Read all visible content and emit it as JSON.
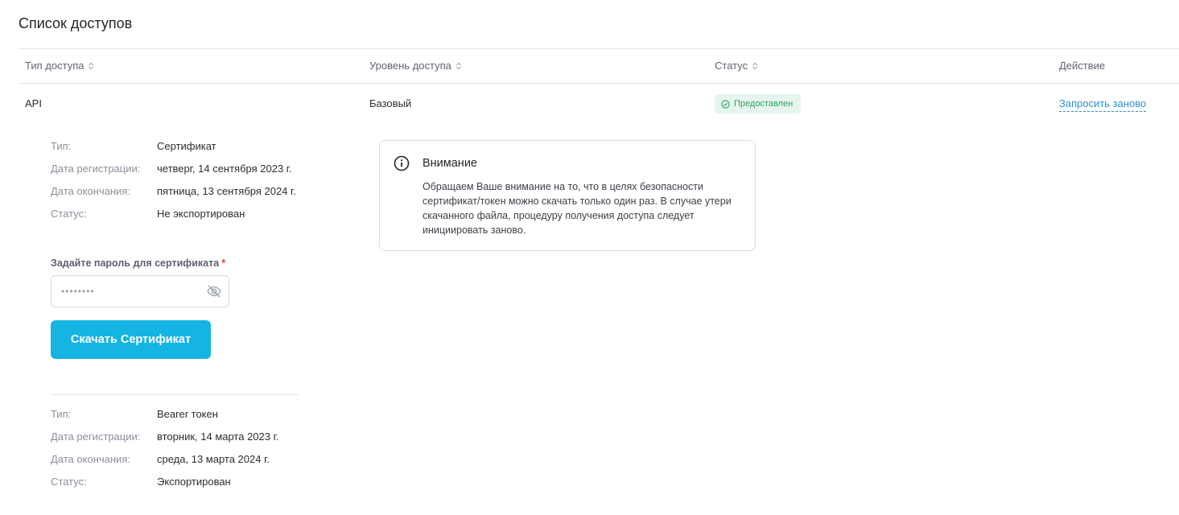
{
  "page": {
    "title": "Список доступов"
  },
  "table": {
    "columns": [
      {
        "label": "Тип доступа",
        "sortable": true
      },
      {
        "label": "Уровень доступа",
        "sortable": true
      },
      {
        "label": "Статус",
        "sortable": true
      },
      {
        "label": "Действие",
        "sortable": false
      }
    ],
    "row": {
      "type": "API",
      "level": "Базовый",
      "status": "Предоставлен",
      "status_color": "#2f9e63",
      "action": "Запросить заново"
    }
  },
  "certificate": {
    "fields": [
      {
        "term": "Тип:",
        "value": "Сертификат"
      },
      {
        "term": "Дата регистрации:",
        "value": "четверг, 14 сентября 2023 г."
      },
      {
        "term": "Дата окончания:",
        "value": "пятница, 13 сентября 2024 г."
      },
      {
        "term": "Статус:",
        "value": "Не экспортирован"
      }
    ],
    "password_label": "Задайте пароль для сертификата",
    "password_required_mark": "*",
    "password_value": "••••••••",
    "download_label": "Скачать Сертификат",
    "accent_color": "#14b4e3"
  },
  "token": {
    "fields": [
      {
        "term": "Тип:",
        "value": "Bearer токен"
      },
      {
        "term": "Дата регистрации:",
        "value": "вторник, 14 марта 2023 г."
      },
      {
        "term": "Дата окончания:",
        "value": "среда, 13 марта 2024 г."
      },
      {
        "term": "Статус:",
        "value": "Экспортирован"
      }
    ]
  },
  "alert": {
    "icon": "info-icon",
    "title": "Внимание",
    "text": "Обращаем Ваше внимание на то, что в целях безопасности сертификат/токен можно скачать только один раз. В случае утери скачанного файла, процедуру получения доступа следует инициировать заново."
  }
}
